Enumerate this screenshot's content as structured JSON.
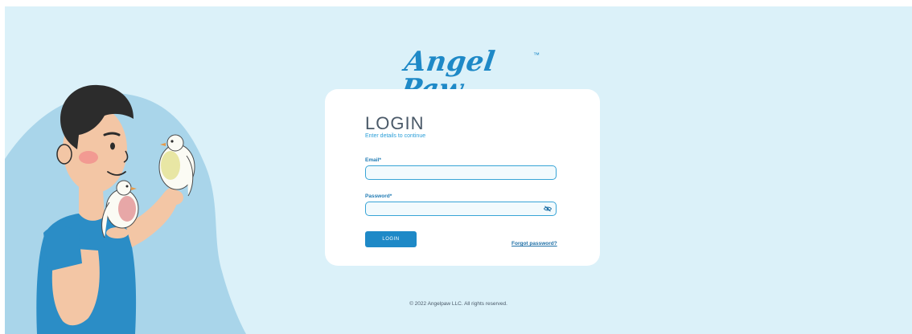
{
  "brand": {
    "logo_text": "Angel Paw",
    "logo_tm": "™"
  },
  "login": {
    "title": "LOGIN",
    "subtitle": "Enter details to continue",
    "email_label": "Email*",
    "email_value": "",
    "password_label": "Password*",
    "password_value": "",
    "login_button": "LOGIN",
    "forgot_link": "Forgot password?"
  },
  "footer": {
    "copyright": "© 2022 Angelpaw LLC. All rights reserved."
  },
  "icons": {
    "password_toggle": "eye-slash-icon"
  },
  "colors": {
    "page_background": "#dbf1f9",
    "brand_blue": "#1e89c7",
    "field_border": "#38a4d6",
    "card_background": "#ffffff"
  }
}
